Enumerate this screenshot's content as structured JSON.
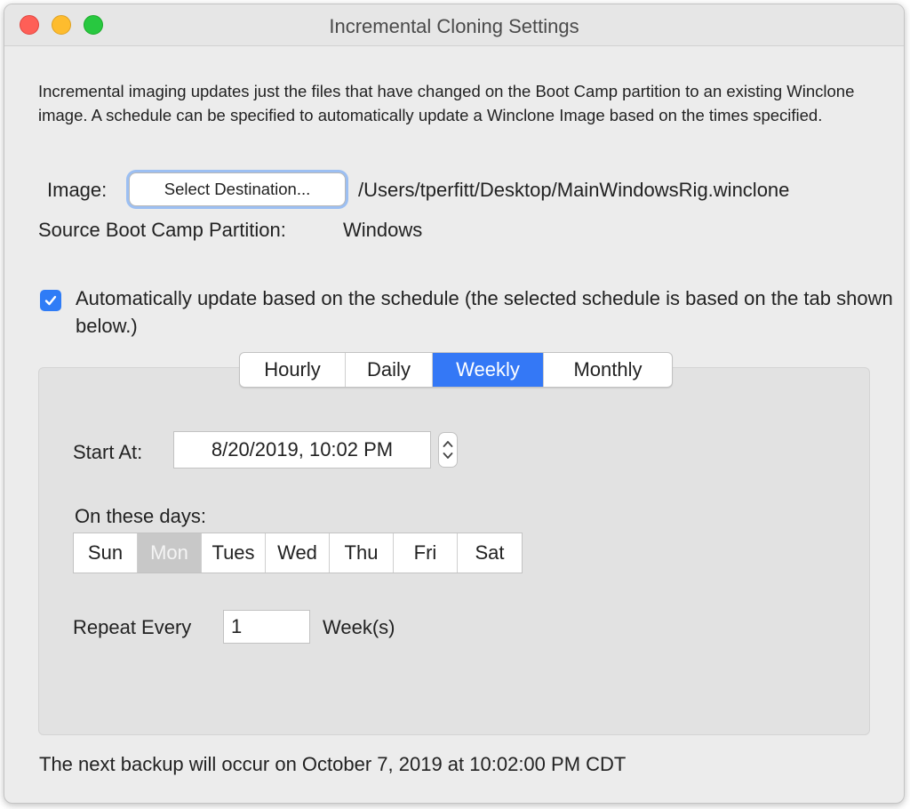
{
  "window": {
    "title": "Incremental Cloning Settings"
  },
  "description": "Incremental imaging updates just the files that have changed on the Boot Camp partition to an existing Winclone image. A schedule can be specified to automatically update a Winclone Image based on the times specified.",
  "image": {
    "label": "Image:",
    "button_label": "Select Destination...",
    "path": "/Users/tperfitt/Desktop/MainWindowsRig.winclone"
  },
  "source": {
    "label": "Source Boot Camp Partition:",
    "value": "Windows"
  },
  "auto_update": {
    "checked": true,
    "label": "Automatically update based on the schedule (the selected schedule is based on the tab shown below.)"
  },
  "tabs": [
    {
      "label": "Hourly",
      "active": false
    },
    {
      "label": "Daily",
      "active": false
    },
    {
      "label": "Weekly",
      "active": true
    },
    {
      "label": "Monthly",
      "active": false
    }
  ],
  "weekly": {
    "start_label": "Start At:",
    "start_value": "8/20/2019, 10:02 PM",
    "days_label": "On these days:",
    "days": [
      {
        "label": "Sun",
        "selected": false
      },
      {
        "label": "Mon",
        "selected": true
      },
      {
        "label": "Tues",
        "selected": false
      },
      {
        "label": "Wed",
        "selected": false
      },
      {
        "label": "Thu",
        "selected": false
      },
      {
        "label": "Fri",
        "selected": false
      },
      {
        "label": "Sat",
        "selected": false
      }
    ],
    "repeat_label": "Repeat Every",
    "repeat_value": "1",
    "repeat_unit": "Week(s)"
  },
  "next_backup": "The next backup will occur on October 7, 2019 at 10:02:00 PM CDT",
  "colors": {
    "accent": "#3478f6",
    "close": "#fe5f57",
    "minimize": "#febc2e",
    "zoom": "#28c840"
  }
}
